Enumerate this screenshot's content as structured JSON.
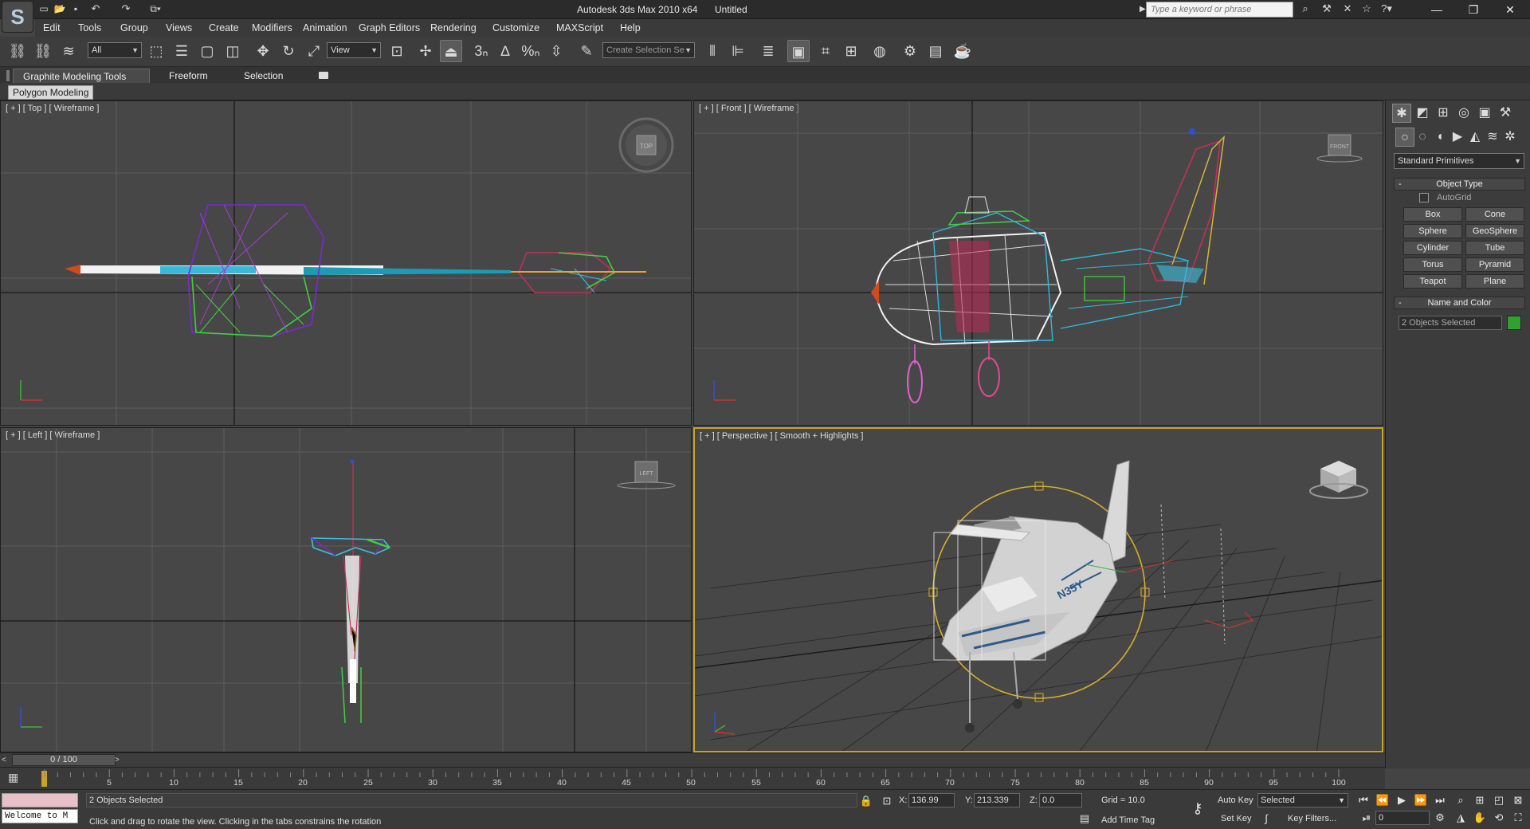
{
  "app": {
    "title": "Autodesk 3ds Max  2010 x64",
    "document": "Untitled",
    "logo": "S",
    "search_placeholder": "Type a keyword or phrase"
  },
  "menus": [
    "Edit",
    "Tools",
    "Group",
    "Views",
    "Create",
    "Modifiers",
    "Animation",
    "Graph Editors",
    "Rendering",
    "Customize",
    "MAXScript",
    "Help"
  ],
  "toolbar": {
    "filter_value": "All",
    "refcoord_value": "View",
    "selection_set_placeholder": "Create Selection Se"
  },
  "ribbon": {
    "tabs": [
      "Graphite Modeling Tools",
      "Freeform",
      "Selection"
    ],
    "panel": "Polygon Modeling"
  },
  "viewports": {
    "top": "[ + ] [ Top ] [ Wireframe ]",
    "front": "[ + ] [ Front ] [ Wireframe ]",
    "left": "[ + ] [ Left ] [ Wireframe ]",
    "perspective": "[ + ] [ Perspective ] [ Smooth + Highlights ]",
    "cube_top": "TOP",
    "cube_front": "FRONT",
    "cube_left": "LEFT",
    "tail_number": "N35Y"
  },
  "command_panel": {
    "category": "Standard Primitives",
    "object_type_header": "Object Type",
    "autogrid": "AutoGrid",
    "primitives": [
      "Box",
      "Cone",
      "Sphere",
      "GeoSphere",
      "Cylinder",
      "Tube",
      "Torus",
      "Pyramid",
      "Teapot",
      "Plane"
    ],
    "name_color_header": "Name and Color",
    "name_value": "2 Objects Selected",
    "object_color": "#2fa12f"
  },
  "timeline": {
    "slider": "0 / 100",
    "ticks": [
      "5",
      "10",
      "15",
      "20",
      "25",
      "30",
      "35",
      "40",
      "45",
      "50",
      "55",
      "60",
      "65",
      "70",
      "75",
      "80",
      "85",
      "90",
      "95",
      "100"
    ]
  },
  "status": {
    "listener": "Welcome to M",
    "selection_count": "2 Objects Selected",
    "prompt": "Click and drag to rotate the view.  Clicking in the tabs constrains the rotation",
    "x_label": "X:",
    "x_value": "136.99",
    "y_label": "Y:",
    "y_value": "213.339",
    "z_label": "Z:",
    "z_value": "0.0",
    "grid": "Grid = 10.0",
    "add_time_tag": "Add Time Tag",
    "auto_key": "Auto Key",
    "set_key": "Set Key",
    "key_mode": "Selected",
    "key_filters": "Key Filters...",
    "frame": "0"
  }
}
